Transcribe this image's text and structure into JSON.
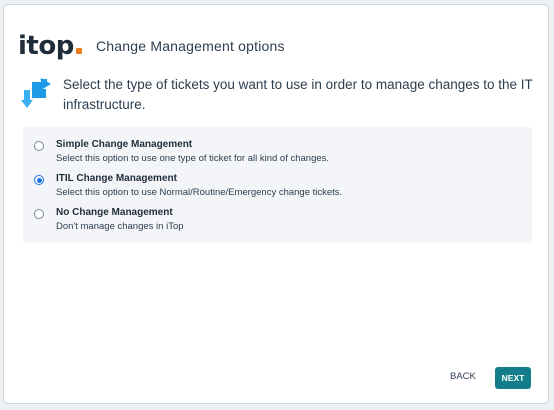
{
  "brand": {
    "logo_text": "itop"
  },
  "header": {
    "title": "Change Management options"
  },
  "intro": {
    "icon": "change-arrows-icon",
    "text": "Select the type of tickets you want to use in order to manage changes to the IT infrastructure."
  },
  "options": [
    {
      "label": "Simple Change Management",
      "description": "Select this option to use one type of ticket for all kind of changes.",
      "selected": false
    },
    {
      "label": "ITIL Change Management",
      "description": "Select this option to use Normal/Routine/Emergency change tickets.",
      "selected": true
    },
    {
      "label": "No Change Management",
      "description": "Don't manage changes in iTop",
      "selected": false
    }
  ],
  "footer": {
    "back_label": "BACK",
    "next_label": "NEXT"
  },
  "colors": {
    "accent": "#137e8a",
    "logo_dot": "#ea7d1e",
    "radio_selected": "#1a73e8",
    "icon_blue": "#1e9be6"
  }
}
